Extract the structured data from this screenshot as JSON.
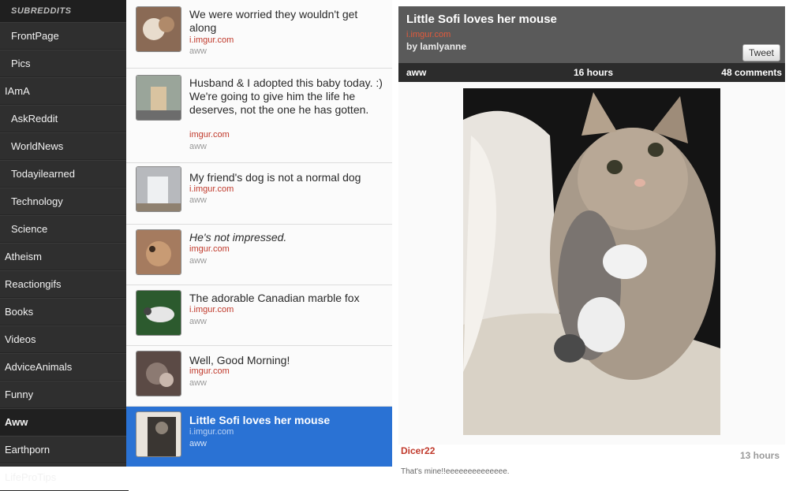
{
  "sidebar": {
    "header": "SUBREDDITS",
    "items": [
      {
        "label": "FrontPage"
      },
      {
        "label": "Pics"
      },
      {
        "label": "IAmA"
      },
      {
        "label": "AskReddit"
      },
      {
        "label": "WorldNews"
      },
      {
        "label": "Todayilearned"
      },
      {
        "label": "Technology"
      },
      {
        "label": "Science"
      },
      {
        "label": "Atheism"
      },
      {
        "label": "Reactiongifs"
      },
      {
        "label": "Books"
      },
      {
        "label": "Videos"
      },
      {
        "label": "AdviceAnimals"
      },
      {
        "label": "Funny"
      },
      {
        "label": "Aww"
      },
      {
        "label": "Earthporn"
      },
      {
        "label": "LifeProTips"
      }
    ]
  },
  "posts": [
    {
      "title": "We were worried they wouldn't get along",
      "domain": "i.imgur.com",
      "subreddit": "aww"
    },
    {
      "title": "Husband & I adopted this baby today. :) We're going to give him the life he deserves, not the one he has gotten.",
      "domain": "imgur.com",
      "subreddit": "aww"
    },
    {
      "title": "My friend's dog is not a normal dog",
      "domain": "i.imgur.com",
      "subreddit": "aww"
    },
    {
      "title": "He's not impressed.",
      "domain": "imgur.com",
      "subreddit": "aww"
    },
    {
      "title": "The adorable Canadian marble fox",
      "domain": "i.imgur.com",
      "subreddit": "aww"
    },
    {
      "title": "Well, Good Morning!",
      "domain": "imgur.com",
      "subreddit": "aww"
    },
    {
      "title": "Little Sofi loves her mouse",
      "domain": "i.imgur.com",
      "subreddit": "aww"
    }
  ],
  "detail": {
    "title": "Little Sofi loves her mouse",
    "domain": "i.imgur.com",
    "author": "by lamlyanne",
    "tweet_label": "Tweet",
    "subreddit": "aww",
    "age": "16 hours",
    "comments": "48 comments"
  },
  "comment": {
    "author": "Dicer22",
    "time": "13 hours",
    "text": "That's mine!!eeeeeeeeeeeeee."
  },
  "colors": {
    "accent_selected": "#2a72d4",
    "domain_red": "#c0392b",
    "sidebar_bg": "#2f2f2f"
  }
}
